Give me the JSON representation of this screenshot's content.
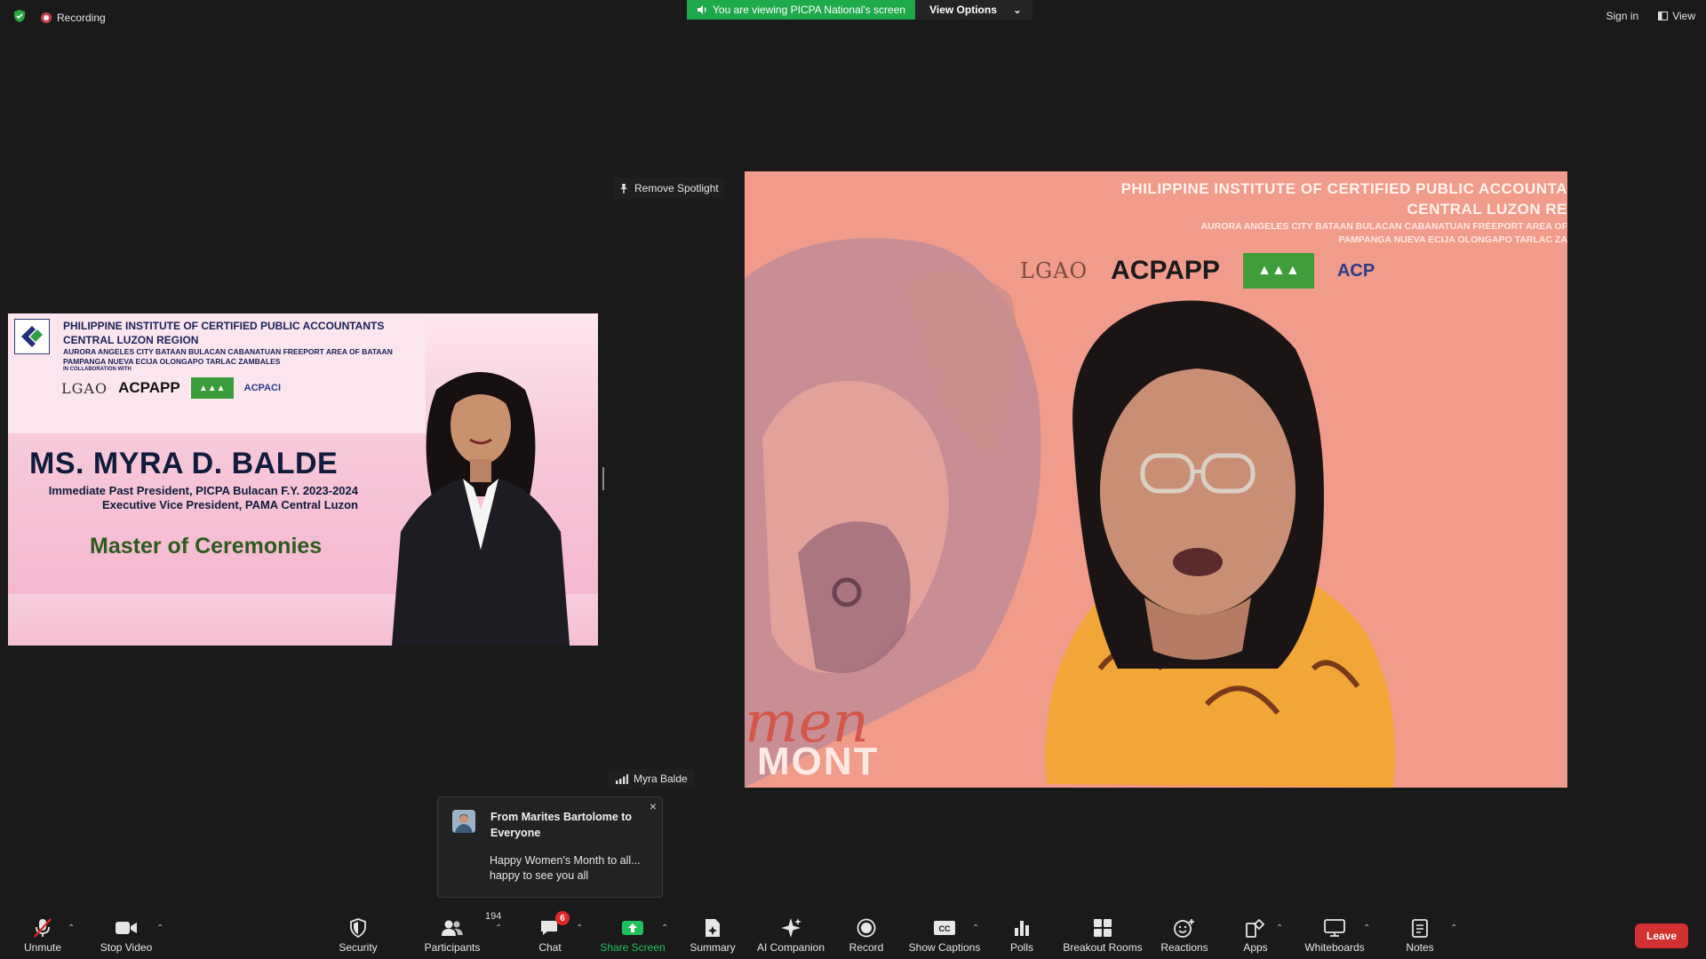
{
  "top": {
    "recording_label": "Recording",
    "viewing_banner": "You are viewing PICPA National's screen",
    "view_options_label": "View Options",
    "sign_in_label": "Sign in",
    "view_label": "View"
  },
  "spotlight": {
    "label": "Remove Spotlight"
  },
  "slide": {
    "org_line1": "PHILIPPINE INSTITUTE OF CERTIFIED PUBLIC ACCOUNTANTS",
    "org_line2": "CENTRAL LUZON REGION",
    "chapters_line1": "AURORA  ANGELES CITY  BATAAN  BULACAN  CABANATUAN  FREEPORT AREA OF BATAAN",
    "chapters_line2": "PAMPANGA  NUEVA ECIJA  OLONGAPO  TARLAC  ZAMBALES",
    "collab": "IN COLLABORATION WITH",
    "logo_lgao": "LGAO",
    "logo_acpapp": "ACPAPP",
    "logo_acpaci": "ACPACI",
    "name": "MS. MYRA D. BALDE",
    "role1": "Immediate Past President, PICPA Bulacan F.Y. 2023-2024",
    "role2": "Executive Vice President, PAMA Central Luzon",
    "mc": "Master of Ceremonies"
  },
  "video": {
    "title1": "PHILIPPINE INSTITUTE OF CERTIFIED PUBLIC ACCOUNTA",
    "title2": "CENTRAL LUZON RE",
    "chapters_line1": "AURORA  ANGELES CITY  BATAAN  BULACAN  CABANATUAN  FREEPORT AREA OF",
    "chapters_line2": "PAMPANGA  NUEVA ECIJA  OLONGAPO  TARLAC  ZA",
    "logo_lgao": "LGAO",
    "logo_acpapp": "ACPAPP",
    "logo_acpaci": "ACP",
    "men_text": "men",
    "mont_text": "MONT",
    "participant_name": "Myra Balde"
  },
  "toast": {
    "title": "From Marites Bartolome to Everyone",
    "message": "Happy Women's  Month to all... happy to see you all",
    "close": "×"
  },
  "toolbar": {
    "unmute": "Unmute",
    "stop_video": "Stop Video",
    "security": "Security",
    "participants": "Participants",
    "participants_count": "194",
    "chat": "Chat",
    "chat_badge": "6",
    "share_screen": "Share Screen",
    "summary": "Summary",
    "ai_companion": "AI Companion",
    "record": "Record",
    "show_captions": "Show Captions",
    "polls": "Polls",
    "breakout_rooms": "Breakout Rooms",
    "reactions": "Reactions",
    "apps": "Apps",
    "whiteboards": "Whiteboards",
    "notes": "Notes",
    "leave": "Leave"
  },
  "colors": {
    "background": "#1a1a1a",
    "viewing_green": "#1ea94b",
    "leave_red": "#d33030",
    "share_green": "#1ec05a"
  }
}
